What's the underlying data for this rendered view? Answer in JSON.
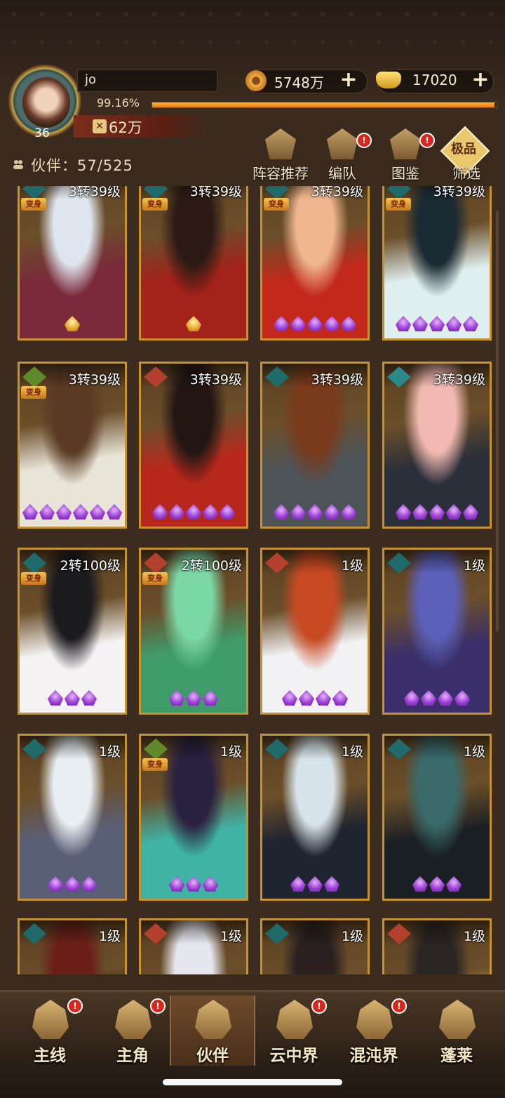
{
  "player": {
    "name": "jo",
    "level": "36",
    "exp_percent_text": "99.16%",
    "exp_fraction": 0.9916,
    "power": "62万"
  },
  "currencies": [
    {
      "icon": "copper-coin-icon",
      "value": "5748万"
    },
    {
      "icon": "gold-ingot-icon",
      "value": "17020"
    }
  ],
  "partner_count": "伙伴：57/525",
  "menu": [
    {
      "label": "阵容推荐",
      "icon": "lineup-recommend-icon",
      "badge": false
    },
    {
      "label": "编队",
      "icon": "formation-icon",
      "badge": true
    },
    {
      "label": "图鉴",
      "icon": "codex-icon",
      "badge": true
    },
    {
      "label": "筛选",
      "icon": "filter-icon",
      "badge": false,
      "tag": "极品"
    }
  ],
  "badge_mark": "!",
  "bianshen_tag": "变身",
  "cards": [
    {
      "level": "3转39级",
      "faction": "demon",
      "bianshen": true,
      "stars": 1,
      "star_type": "gold",
      "colors": [
        "#dfe6ef",
        "#7a2a3a"
      ]
    },
    {
      "level": "3转39级",
      "faction": "demon",
      "bianshen": true,
      "stars": 1,
      "star_type": "gold",
      "colors": [
        "#2b1a14",
        "#a3221a"
      ]
    },
    {
      "level": "3转39级",
      "faction": "demon",
      "bianshen": true,
      "stars": 5,
      "star_type": "purple",
      "colors": [
        "#f0b68f",
        "#c3281b"
      ]
    },
    {
      "level": "3转39级",
      "faction": "demon",
      "bianshen": true,
      "stars": 5,
      "star_type": "purple",
      "colors": [
        "#1a2a33",
        "#dfeeee"
      ]
    },
    {
      "level": "3转39级",
      "faction": "leaf",
      "bianshen": true,
      "stars": 6,
      "star_type": "purple",
      "colors": [
        "#5a3a22",
        "#e9e4d8"
      ]
    },
    {
      "level": "3转39级",
      "faction": "fox",
      "bianshen": false,
      "stars": 5,
      "star_type": "purple",
      "colors": [
        "#231612",
        "#b8271c"
      ]
    },
    {
      "level": "3转39级",
      "faction": "demon",
      "bianshen": false,
      "stars": 5,
      "star_type": "purple",
      "colors": [
        "#7a3a1c",
        "#4e5358"
      ]
    },
    {
      "level": "3转39级",
      "faction": "water",
      "bianshen": false,
      "stars": 5,
      "star_type": "purple",
      "colors": [
        "#f1b9b2",
        "#2b2f3a"
      ]
    },
    {
      "level": "2转100级",
      "faction": "demon",
      "bianshen": true,
      "stars": 3,
      "star_type": "purple",
      "colors": [
        "#1b1a1f",
        "#f4f2f2"
      ]
    },
    {
      "level": "2转100级",
      "faction": "fox",
      "bianshen": true,
      "stars": 3,
      "star_type": "purple",
      "colors": [
        "#7bd8a6",
        "#3f9c6a"
      ]
    },
    {
      "level": "1级",
      "faction": "fox",
      "bianshen": false,
      "stars": 4,
      "star_type": "purple",
      "colors": [
        "#c84a22",
        "#f2f2f4"
      ]
    },
    {
      "level": "1级",
      "faction": "demon",
      "bianshen": false,
      "stars": 4,
      "star_type": "purple",
      "colors": [
        "#5b5fb8",
        "#3a2f6a"
      ]
    },
    {
      "level": "1级",
      "faction": "demon",
      "bianshen": false,
      "stars": 3,
      "star_type": "purple",
      "colors": [
        "#e8eef2",
        "#5a5f78"
      ]
    },
    {
      "level": "1级",
      "faction": "leaf",
      "bianshen": true,
      "stars": 3,
      "star_type": "purple",
      "colors": [
        "#2a2140",
        "#3fb3a6"
      ]
    },
    {
      "level": "1级",
      "faction": "demon",
      "bianshen": false,
      "stars": 3,
      "star_type": "purple",
      "colors": [
        "#d7e4ea",
        "#1e2430"
      ]
    },
    {
      "level": "1级",
      "faction": "demon",
      "bianshen": false,
      "stars": 3,
      "star_type": "purple",
      "colors": [
        "#3a6a6a",
        "#1a1f24"
      ]
    },
    {
      "level": "1级",
      "faction": "demon",
      "bianshen": false,
      "stars": 0,
      "star_type": "purple",
      "colors": [
        "#6a2018",
        "#2b1c14"
      ]
    },
    {
      "level": "1级",
      "faction": "fox",
      "bianshen": false,
      "stars": 0,
      "star_type": "purple",
      "colors": [
        "#e6e6ee",
        "#4a3a2a"
      ]
    },
    {
      "level": "1级",
      "faction": "demon",
      "bianshen": false,
      "stars": 0,
      "star_type": "purple",
      "colors": [
        "#2a2020",
        "#6a4a3a"
      ]
    },
    {
      "level": "1级",
      "faction": "fox",
      "bianshen": false,
      "stars": 0,
      "star_type": "purple",
      "colors": [
        "#2a2522",
        "#c8a060"
      ]
    }
  ],
  "nav": [
    {
      "label": "主线",
      "icon": "main-quest-icon",
      "badge": true,
      "active": false
    },
    {
      "label": "主角",
      "icon": "hero-icon",
      "badge": true,
      "active": false
    },
    {
      "label": "伙伴",
      "icon": "partner-icon",
      "badge": false,
      "active": true
    },
    {
      "label": "云中界",
      "icon": "cloud-realm-icon",
      "badge": true,
      "active": false
    },
    {
      "label": "混沌界",
      "icon": "chaos-realm-icon",
      "badge": true,
      "active": false
    },
    {
      "label": "蓬莱",
      "icon": "penglai-icon",
      "badge": false,
      "active": false
    }
  ],
  "faction_colors": {
    "demon": "#1f6b6b",
    "leaf": "#5f8a2a",
    "fox": "#b3402c",
    "water": "#2a8a8a"
  }
}
